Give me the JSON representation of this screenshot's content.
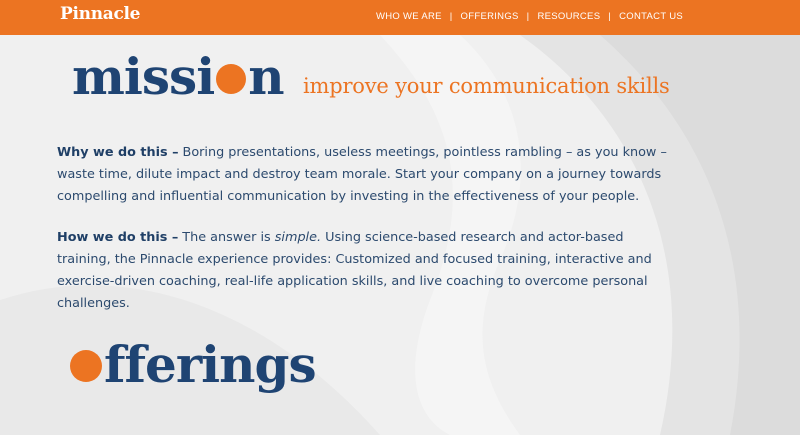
{
  "header": {
    "logo": "Pinnacle",
    "nav": [
      "WHO WE ARE",
      "OFFERINGS",
      "RESOURCES",
      "CONTACT US"
    ],
    "separator": "|",
    "colors": {
      "bar": "#ec7422",
      "text": "#ffffff"
    }
  },
  "mission": {
    "title_before_dot": "missi",
    "title_after_dot": "n",
    "tagline": "improve your communication skills"
  },
  "why": {
    "lead": "Why we do this –",
    "text": " Boring presentations, useless meetings, pointless rambling – as you know – waste time, dilute impact and destroy team morale. Start your company on a journey towards compelling and influential communication by investing in the effectiveness of your people."
  },
  "how": {
    "lead": "How we do this –",
    "text_before": " The answer is ",
    "emphasis": "simple.",
    "text_after": "  Using science-based research and actor-based training, the Pinnacle experience provides: Customized and focused training, interactive and exercise-driven coaching, real-life application skills, and live coaching to overcome personal challenges."
  },
  "offerings": {
    "title_after_dot": "fferings"
  },
  "colors": {
    "accent": "#ec7422",
    "navy": "#1f4473",
    "body_text": "#2c4a6e"
  }
}
